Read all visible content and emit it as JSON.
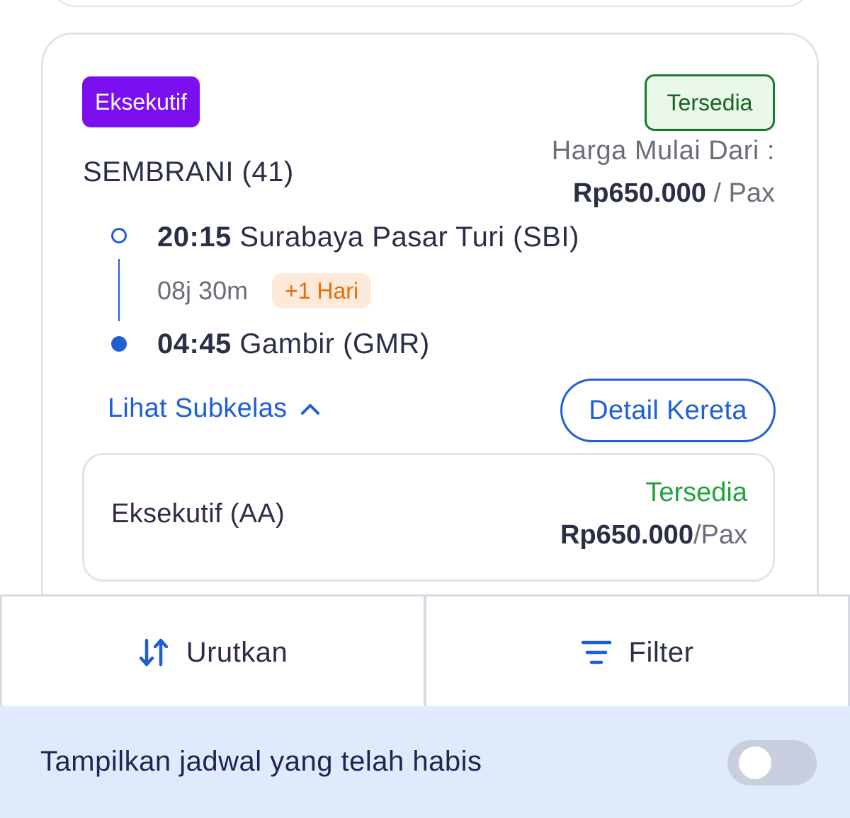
{
  "train": {
    "class_badge": "Eksekutif",
    "availability": "Tersedia",
    "name": "SEMBRANI (41)",
    "price_label": "Harga Mulai Dari :",
    "price": "Rp650.000",
    "price_unit": " / Pax",
    "departure": {
      "time": "20:15",
      "station": " Surabaya Pasar Turi (SBI)"
    },
    "duration": "08j 30m",
    "day_offset": "+1 Hari",
    "arrival": {
      "time": "04:45",
      "station": " Gambir (GMR)"
    },
    "subclass_toggle_label": "Lihat Subkelas",
    "detail_button_label": "Detail Kereta"
  },
  "subclasses": [
    {
      "name": "Eksekutif (AA)",
      "status": "Tersedia",
      "price": "Rp650.000",
      "unit": "/Pax"
    }
  ],
  "actions": {
    "sort_label": "Urutkan",
    "filter_label": "Filter"
  },
  "toggle": {
    "label": "Tampilkan jadwal yang telah habis",
    "enabled": false
  },
  "colors": {
    "primary_blue": "#1f5fd6",
    "class_badge_purple": "#7b0ff0",
    "available_green": "#21a33a",
    "day_badge_orange": "#ea6a0c"
  },
  "icons": {
    "sort": "sort-arrows-icon",
    "filter": "filter-lines-icon",
    "chevron": "chevron-up-icon"
  }
}
